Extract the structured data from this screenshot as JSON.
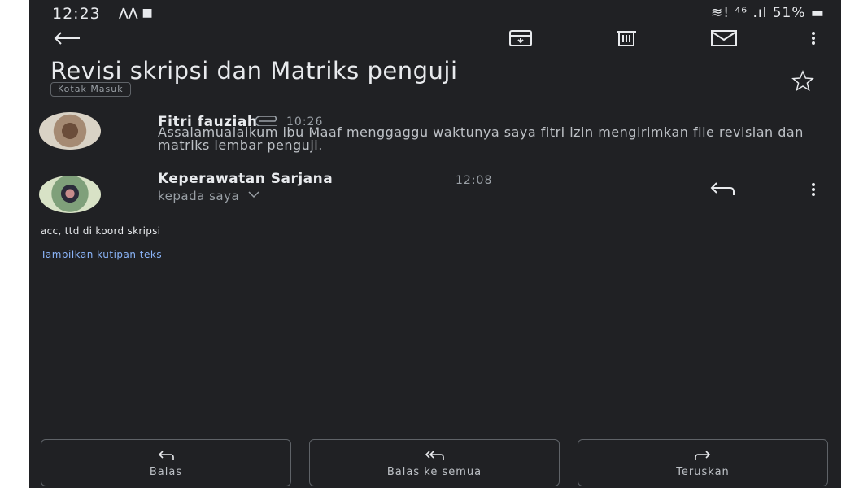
{
  "status_bar": {
    "time": "12:23",
    "left_icons": "⋀⋀ ■",
    "right": "≋! ⁴⁶ .ıl 51% ▬"
  },
  "toolbar": {
    "back_icon": "arrow-left-icon",
    "archive_icon": "archive-icon",
    "delete_icon": "trash-icon",
    "mail_icon": "mail-icon",
    "more_icon": "more-vert-icon"
  },
  "email": {
    "subject": "Revisi skripsi dan Matriks penguji",
    "label": "Kotak Masuk",
    "star_icon": "star-outline-icon"
  },
  "thread": [
    {
      "sender": "Fitri fauziah",
      "time": "10:26",
      "preview": "Assalamualaikum ibu Maaf menggaggu waktunya saya fitri izin mengirimkan file revisian dan matriks lembar penguji."
    },
    {
      "sender": "Keperawatan Sarjana",
      "time": "12:08",
      "recipient": "kepada saya",
      "body": "acc, ttd di koord skripsi",
      "quote_link": "Tampilkan kutipan teks"
    }
  ],
  "actions": {
    "reply": "Balas",
    "reply_all": "Balas ke semua",
    "forward": "Teruskan"
  },
  "colors": {
    "background": "#202124",
    "text": "#e8eaed",
    "secondary_text": "#9aa0a6",
    "link": "#8ab4f8"
  }
}
